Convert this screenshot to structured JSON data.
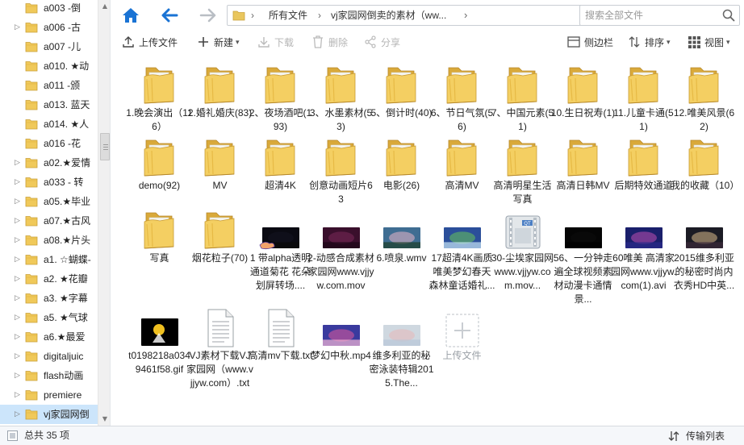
{
  "sidebar": {
    "items": [
      {
        "label": "a003 -倒",
        "expandable": false,
        "selected": false
      },
      {
        "label": "a006 -古",
        "expandable": true,
        "selected": false
      },
      {
        "label": "a007 -儿",
        "expandable": false,
        "selected": false
      },
      {
        "label": "a010. ★动",
        "expandable": false,
        "selected": false
      },
      {
        "label": "a011 -颁",
        "expandable": false,
        "selected": false
      },
      {
        "label": "a013. 蓝天",
        "expandable": false,
        "selected": false
      },
      {
        "label": "a014. ★人",
        "expandable": false,
        "selected": false
      },
      {
        "label": "a016 -花",
        "expandable": false,
        "selected": false
      },
      {
        "label": "a02.★爱情",
        "expandable": true,
        "selected": false
      },
      {
        "label": "a033 - 转",
        "expandable": true,
        "selected": false
      },
      {
        "label": "a05.★毕业",
        "expandable": true,
        "selected": false
      },
      {
        "label": "a07.★古风",
        "expandable": true,
        "selected": false
      },
      {
        "label": "a08.★片头",
        "expandable": true,
        "selected": false
      },
      {
        "label": "a1. ☆蝴蝶-",
        "expandable": true,
        "selected": false
      },
      {
        "label": "a2. ★花瓣",
        "expandable": true,
        "selected": false
      },
      {
        "label": "a3. ★字幕",
        "expandable": true,
        "selected": false
      },
      {
        "label": "a5. ★气球",
        "expandable": true,
        "selected": false
      },
      {
        "label": "a6.★最爱",
        "expandable": true,
        "selected": false
      },
      {
        "label": "digitaljuic",
        "expandable": true,
        "selected": false
      },
      {
        "label": "flash动画",
        "expandable": true,
        "selected": false
      },
      {
        "label": "premiere",
        "expandable": true,
        "selected": false
      },
      {
        "label": "vj家园网倒",
        "expandable": true,
        "selected": true
      }
    ]
  },
  "address": {
    "root_label": "所有文件",
    "current_folder": "vj家园网倒卖的素材（ww...",
    "search_placeholder": "搜索全部文件"
  },
  "toolbar": {
    "upload": "上传文件",
    "new": "新建",
    "download": "下载",
    "delete": "删除",
    "share": "分享",
    "sidebar": "侧边栏",
    "sort": "排序",
    "view": "视图"
  },
  "files": [
    {
      "name": "1.晚会演出（116）",
      "kind": "folder"
    },
    {
      "name": "2.婚礼婚庆(83)",
      "kind": "folder"
    },
    {
      "name": "2、夜场酒吧(193)",
      "kind": "folder"
    },
    {
      "name": "3、水墨素材(53)",
      "kind": "folder"
    },
    {
      "name": "5、倒计时(40)",
      "kind": "folder"
    },
    {
      "name": "6、节日气氛(56)",
      "kind": "folder"
    },
    {
      "name": "7、中国元素(51)",
      "kind": "folder"
    },
    {
      "name": "10.生日祝寿(1)",
      "kind": "folder"
    },
    {
      "name": "11.儿童卡通(51)",
      "kind": "folder"
    },
    {
      "name": "12.唯美风景(62)",
      "kind": "folder"
    },
    {
      "name": "demo(92)",
      "kind": "folder"
    },
    {
      "name": "MV",
      "kind": "folder"
    },
    {
      "name": "超清4K",
      "kind": "folder"
    },
    {
      "name": "创意动画短片63",
      "kind": "folder"
    },
    {
      "name": "电影(26)",
      "kind": "folder"
    },
    {
      "name": "高清MV",
      "kind": "folder"
    },
    {
      "name": "高清明星生活写真",
      "kind": "folder"
    },
    {
      "name": "高清日韩MV",
      "kind": "folder"
    },
    {
      "name": "后期特效通道",
      "kind": "folder"
    },
    {
      "name": "我的收藏（10）",
      "kind": "folder"
    },
    {
      "name": "写真",
      "kind": "folder"
    },
    {
      "name": "烟花粒子(70)",
      "kind": "folder"
    },
    {
      "name": "1 带alpha透明通道菊花 花朵划屏转场....",
      "kind": "video",
      "thumb_colors": [
        "#0a0a12",
        "#141420",
        "#0a0a0a"
      ]
    },
    {
      "name": "2-动感合成素材家园网www.vjjyw.com.mov",
      "kind": "video",
      "thumb_colors": [
        "#3a0f2c",
        "#7a2a5a",
        "#1b0516"
      ]
    },
    {
      "name": "6.喷泉.wmv",
      "kind": "video",
      "thumb_colors": [
        "#3f6d92",
        "#e9b6c8",
        "#1c3e2a"
      ]
    },
    {
      "name": "17超清4K画质唯美梦幻春天森林童话婚礼...",
      "kind": "video",
      "thumb_colors": [
        "#2b4f9a",
        "#68c45a",
        "#c8e6f5"
      ]
    },
    {
      "name": "30-尘埃家园网www.vjjyw.com.mov...",
      "kind": "qt"
    },
    {
      "name": "56、一分钟走遍全球视频素材动漫卡通情景...",
      "kind": "video",
      "thumb_colors": [
        "#050505",
        "#0d0d0d",
        "#000000"
      ]
    },
    {
      "name": "60唯美 高清家园网www.vjjyw.com(1).avi",
      "kind": "video",
      "thumb_colors": [
        "#1a1f6b",
        "#c04fb0",
        "#2b2b8a"
      ]
    },
    {
      "name": "2015维多利亚的秘密时尚内衣秀HD中英...",
      "kind": "video",
      "thumb_colors": [
        "#1b1b24",
        "#d9b98b",
        "#3a2a3a"
      ]
    },
    {
      "name": "t0198218a0349461f58.gif",
      "kind": "gif",
      "thumb_colors": [
        "#000000",
        "#f0c020",
        "#ffffff"
      ]
    },
    {
      "name": "VJ素材下载VJ家园网（www.vjjyw.com）.txt",
      "kind": "txt"
    },
    {
      "name": "高清mv下载.txt",
      "kind": "txt"
    },
    {
      "name": "梦幻中秋.mp4",
      "kind": "video",
      "thumb_colors": [
        "#3a3a9e",
        "#e15a9a",
        "#f3b6d6"
      ]
    },
    {
      "name": "维多利亚的秘密泳装特辑2015.The...",
      "kind": "video",
      "thumb_colors": [
        "#cfd8e0",
        "#e8b8b8",
        "#b8c8d8"
      ]
    },
    {
      "name": "上传文件",
      "kind": "upload"
    }
  ],
  "status": {
    "total": "总共 35 项",
    "transfer": "传输列表"
  }
}
